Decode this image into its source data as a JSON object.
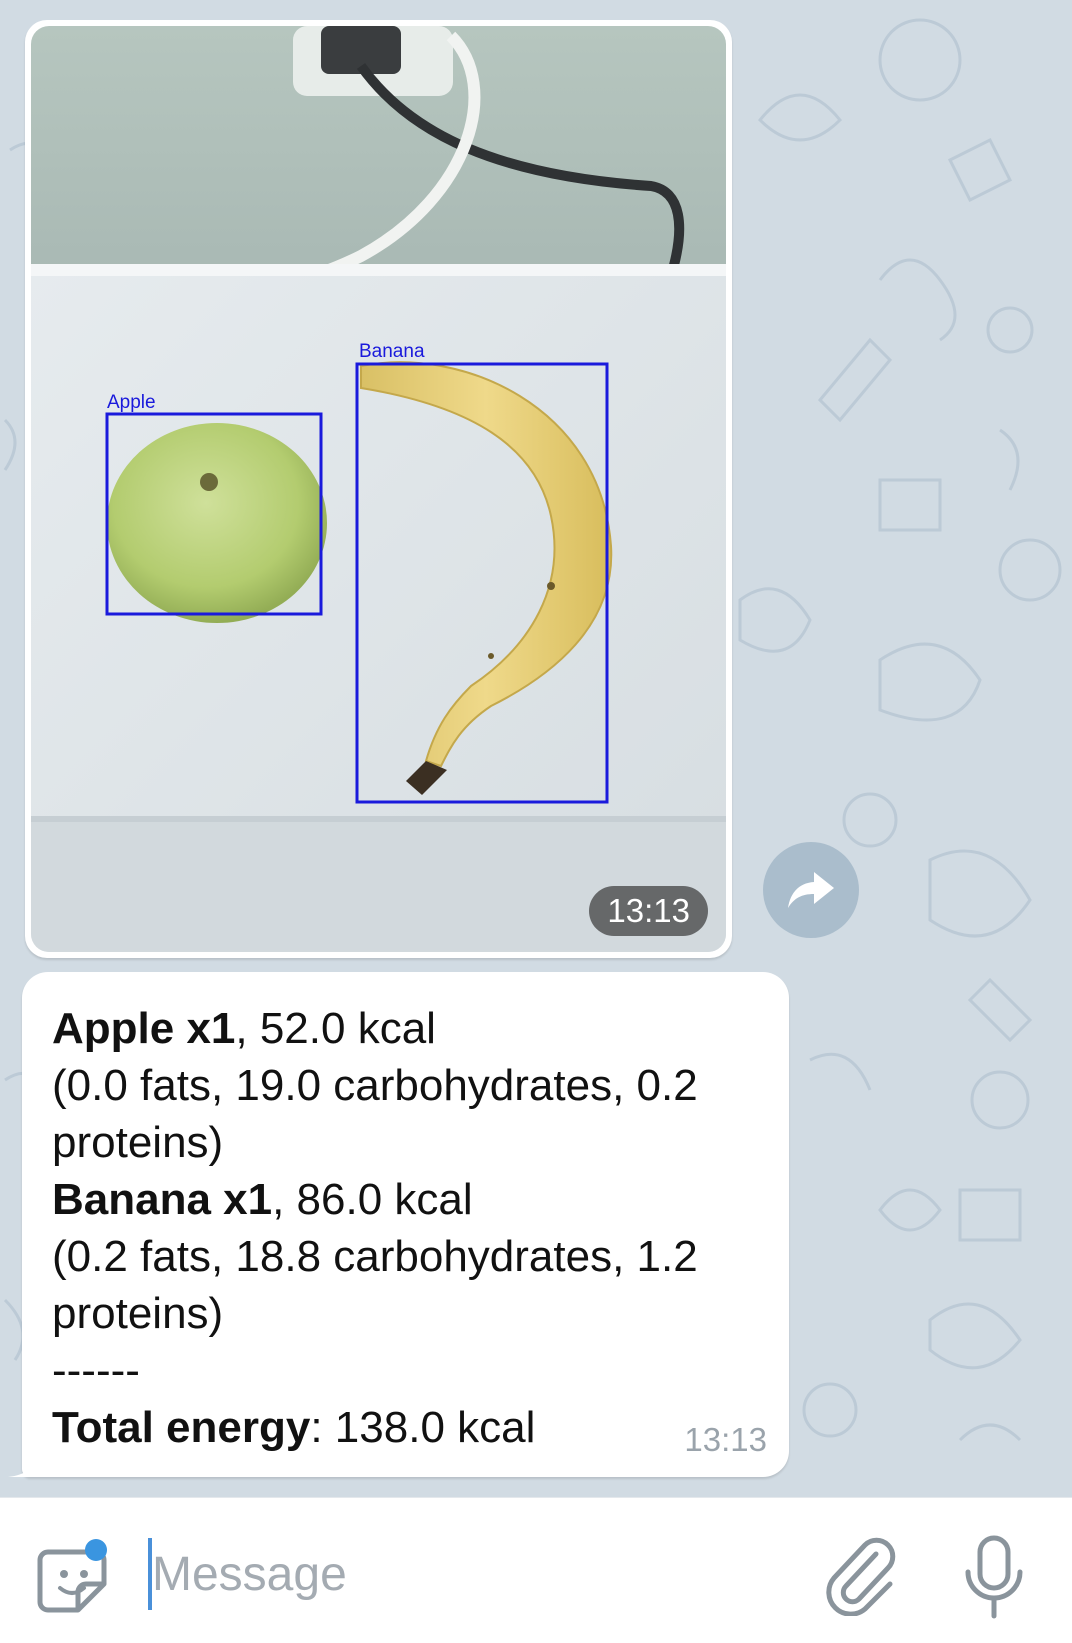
{
  "chat": {
    "photo_message": {
      "time": "13:13",
      "detections": [
        {
          "label": "Apple"
        },
        {
          "label": "Banana"
        }
      ]
    },
    "text_message": {
      "apple_name": "Apple x1",
      "apple_kcal": ", 52.0 kcal",
      "apple_macros_1": "(0.0 fats, 19.0 carbohydrates, 0.2",
      "apple_macros_2": "proteins)",
      "banana_name": "Banana x1",
      "banana_kcal": ", 86.0 kcal",
      "banana_macros_1": "(0.2 fats, 18.8 carbohydrates, 1.2",
      "banana_macros_2": "proteins)",
      "separator": "------",
      "total_label": "Total energy",
      "total_value": ": 138.0 kcal",
      "time": "13:13"
    }
  },
  "input_bar": {
    "placeholder": "Message"
  },
  "icons": {
    "sticker": "sticker-icon",
    "forward": "forward-icon",
    "attach": "paperclip-icon",
    "mic": "microphone-icon"
  },
  "colors": {
    "wallpaper": "#d1dbe3",
    "bubble": "#ffffff",
    "bbox": "#1a1adc",
    "accent": "#4a90d9"
  }
}
